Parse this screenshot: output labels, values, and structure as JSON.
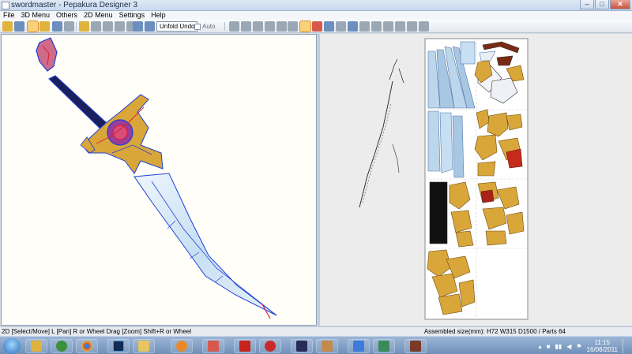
{
  "window": {
    "title": "swordmaster - Pepakura Designer 3"
  },
  "window_buttons": {
    "minimize": "–",
    "maximize": "□",
    "close": "✕"
  },
  "menu": [
    "File",
    "3D Menu",
    "Others",
    "2D Menu",
    "Settings",
    "Help"
  ],
  "toolbar": {
    "unfold_label": "Unfold Undo",
    "auto_label": "Auto"
  },
  "status": {
    "left": "2D [Select/Move] L [Pan] R or Wheel Drag [Zoom] Shift+R or Wheel",
    "right": "Assembled size(mm): H72 W315 D1500 / Parts 64"
  },
  "clock": {
    "time": "11:15",
    "date": "16/06/2011"
  },
  "colors": {
    "pane3d_bg": "#fffef8",
    "pane2d_bg": "#ececec",
    "edge_blue": "#1f3fd8",
    "gold": "#d9a63a",
    "blade": "#c7dff2"
  },
  "taskbar_apps": [
    "start-orb",
    "explorer-icon",
    "winamp-icon",
    "chrome-icon",
    "photoshop-icon",
    "folder-icon",
    "media-player-icon",
    "pepakura-icon",
    "filezilla-icon",
    "opera-icon",
    "game-icon",
    "notepad-icon",
    "snipping-icon",
    "package-icon",
    "books-icon"
  ]
}
